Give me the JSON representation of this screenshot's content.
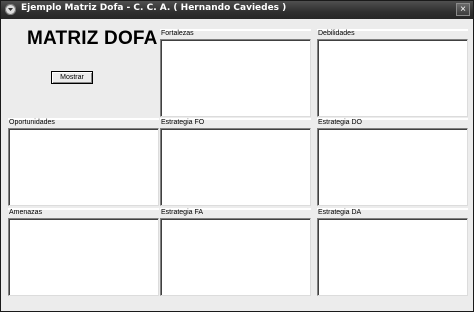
{
  "window": {
    "title": "Ejemplo Matriz Dofa - C. C. A. ( Hernando Caviedes )",
    "close_glyph": "×"
  },
  "main": {
    "heading": "MATRIZ DOFA",
    "show_button_label": "Mostrar"
  },
  "panels": {
    "fortalezas": "Fortalezas",
    "debilidades": "Debilidades",
    "oportunidades": "Oportunidades",
    "estrategia_fo": "Estrategia FO",
    "estrategia_do": "Estrategia DO",
    "amenazas": "Amenazas",
    "estrategia_fa": "Estrategia FA",
    "estrategia_da": "Estrategia DA"
  },
  "colors": {
    "titlebar": "#2f2f2f",
    "client_background": "#ececec",
    "textarea_background": "#ffffff"
  }
}
